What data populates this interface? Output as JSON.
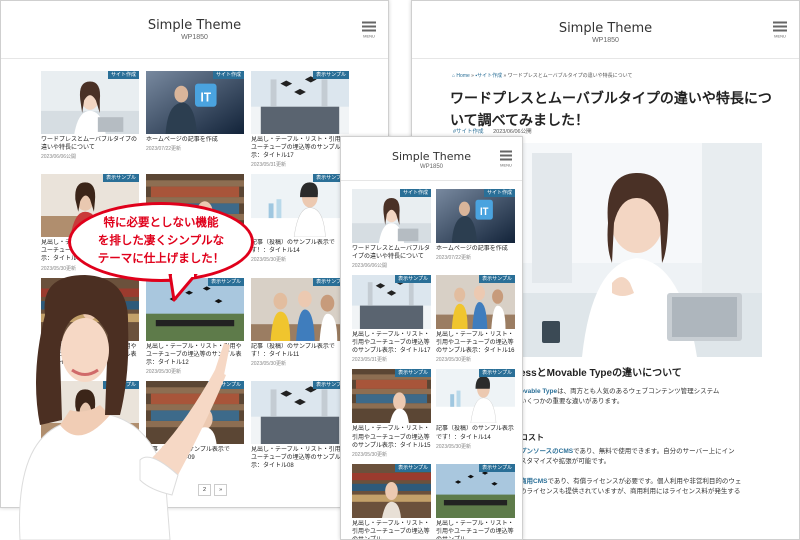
{
  "site": {
    "title": "Simple Theme",
    "subtitle": "WP1850",
    "menu_label": "MENU"
  },
  "colors": {
    "accent": "#2a6f97",
    "bubble": "#e0001b"
  },
  "left_grid": [
    {
      "badge": "サイト作成",
      "title": "ワードプレスとムーバブルタイプの違いや特長について",
      "date": "2023/06/06公開",
      "img": "woman-laptop"
    },
    {
      "badge": "サイト作成",
      "title": "ホームページの記事を作成",
      "date": "2023/07/22更新",
      "img": "it"
    },
    {
      "badge": "表示サンプル",
      "title": "見出し・テーブル・リスト・引用やユーチューブの埋込等のサンプル表示：タイトル17",
      "date": "2023/05/31更新",
      "img": "graduation"
    },
    {
      "badge": "表示サンプル",
      "title": "見出し・テーブル・リスト・引用やユーチューブの埋込等のサンプル表示：タイトル16",
      "date": "2023/05/30更新",
      "img": "study"
    },
    {
      "badge": "",
      "title": "",
      "date": "",
      "img": "library"
    },
    {
      "badge": "表示サンプル",
      "title": "記事（投稿）のサンプル表示です！：タイトル14",
      "date": "2023/05/30更新",
      "img": "lab"
    },
    {
      "badge": "",
      "title": "見出し・テーブル・リスト・引用やユーチューブの埋込等のサンプル表示：タイトル13",
      "date": "",
      "img": "library2"
    },
    {
      "badge": "表示サンプル",
      "title": "見出し・テーブル・リスト・引用やユーチューブの埋込等のサンプル表示：タイトル12",
      "date": "2023/05/30更新",
      "img": "sky-grad"
    },
    {
      "badge": "表示サンプル",
      "title": "記事（投稿）のサンプル表示です！：タイトル11",
      "date": "2023/05/30更新",
      "img": "students"
    },
    {
      "badge": "表示サンプル",
      "title": "",
      "date": "",
      "img": "study"
    },
    {
      "badge": "表示サンプル",
      "title": "記事（投稿）のサンプル表示です！：タイトル09",
      "date": "2023/05/30更新",
      "img": "library"
    },
    {
      "badge": "表示サンプル",
      "title": "見出し・テーブル・リスト・引用やユーチューブの埋込等のサンプル表示：タイトル08",
      "date": "",
      "img": "graduation"
    }
  ],
  "pager": {
    "page2": "2",
    "next": "»"
  },
  "mid_grid": [
    {
      "badge": "サイト作成",
      "title": "ワードプレスとムーバブルタイプの違いや特長について",
      "date": "2023/06/06公開",
      "img": "woman-laptop"
    },
    {
      "badge": "サイト作成",
      "title": "ホームページの記事を作成",
      "date": "2023/07/22更新",
      "img": "it"
    },
    {
      "badge": "表示サンプル",
      "title": "見出し・テーブル・リスト・引用やユーチューブの埋込等のサンプル表示：タイトル17",
      "date": "2023/05/31更新",
      "img": "graduation"
    },
    {
      "badge": "表示サンプル",
      "title": "見出し・テーブル・リスト・引用やユーチューブの埋込等のサンプル表示：タイトル16",
      "date": "2023/05/30更新",
      "img": "students"
    },
    {
      "badge": "表示サンプル",
      "title": "見出し・テーブル・リスト・引用やユーチューブの埋込等のサンプル表示：タイトル15",
      "date": "2023/05/30更新",
      "img": "library"
    },
    {
      "badge": "表示サンプル",
      "title": "記事（投稿）のサンプル表示です！：タイトル14",
      "date": "2023/05/30更新",
      "img": "lab"
    },
    {
      "badge": "表示サンプル",
      "title": "見出し・テーブル・リスト・引用やユーチューブの埋込等のサンプル",
      "date": "",
      "img": "library2"
    },
    {
      "badge": "表示サンプル",
      "title": "見出し・テーブル・リスト・引用やユーチューブの埋込等のサンプル",
      "date": "",
      "img": "sky-grad"
    }
  ],
  "article": {
    "breadcrumb_home": "Home",
    "breadcrumb_cat": "サイト作成",
    "breadcrumb_current": "ワードプレスとムーバブルタイプの違いや特長について",
    "title": "ワードプレスとムーバブルタイプの違いや特長について調べてみました！",
    "tag": "#サイト作成",
    "date": "2023/06/06公開",
    "h2": "essとMovable Typeの違いについて",
    "p1_hl": "ovable Type",
    "p1_text": "は、両方とも人気のあるウェブコンテンツ管理システム",
    "p1_line2": "いくつかの重要な違いがあります。",
    "h3": "コスト",
    "p2_hl": "プンソースのCMS",
    "p2_text": "であり、無料で使用できます。自分のサーバー上にイン",
    "p2_line2": "スタマイズや拡張が可能です。",
    "p3_hl": "商用CMS",
    "p3_text": "であり、有償ライセンスが必要です。個人利用や非営利目的のウェ",
    "p3_line2": "のライセンスも提供されていますが、商用利用にはライセンス料が発生する"
  },
  "bubble": {
    "line1": "特に必要としない機能",
    "line2": "を排した凄くシンプルな",
    "line3": "テーマに仕上げました！"
  }
}
